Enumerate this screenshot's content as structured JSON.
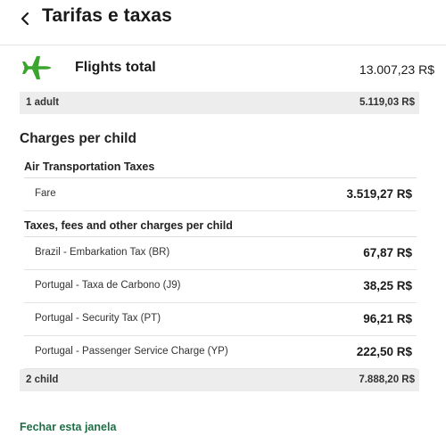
{
  "header": {
    "title": "Tarifas e taxas",
    "back_icon": "chevron-left-icon"
  },
  "flights": {
    "icon": "airplane-icon",
    "icon_color": "#3aa52c",
    "label": "Flights total",
    "total": "13.007,23 R$"
  },
  "adult_summary": {
    "label": "1 adult",
    "value": "5.119,03 R$"
  },
  "charges_section": {
    "title": "Charges per child",
    "air_group": {
      "title": "Air Transportation Taxes",
      "rows": [
        {
          "label": "Fare",
          "value": "3.519,27 R$"
        }
      ]
    },
    "taxes_group": {
      "title": "Taxes, fees and other charges per child",
      "rows": [
        {
          "label": "Brazil - Embarkation Tax (BR)",
          "value": "67,87 R$"
        },
        {
          "label": "Portugal - Taxa de Carbono (J9)",
          "value": "38,25 R$"
        },
        {
          "label": "Portugal - Security Tax (PT)",
          "value": "96,21 R$"
        },
        {
          "label": "Portugal - Passenger Service Charge (YP)",
          "value": "222,50 R$"
        }
      ]
    }
  },
  "child_summary": {
    "label": "2 child",
    "value": "7.888,20 R$"
  },
  "footer": {
    "close_label": "Fechar esta janela",
    "link_color": "#1e6e45"
  }
}
